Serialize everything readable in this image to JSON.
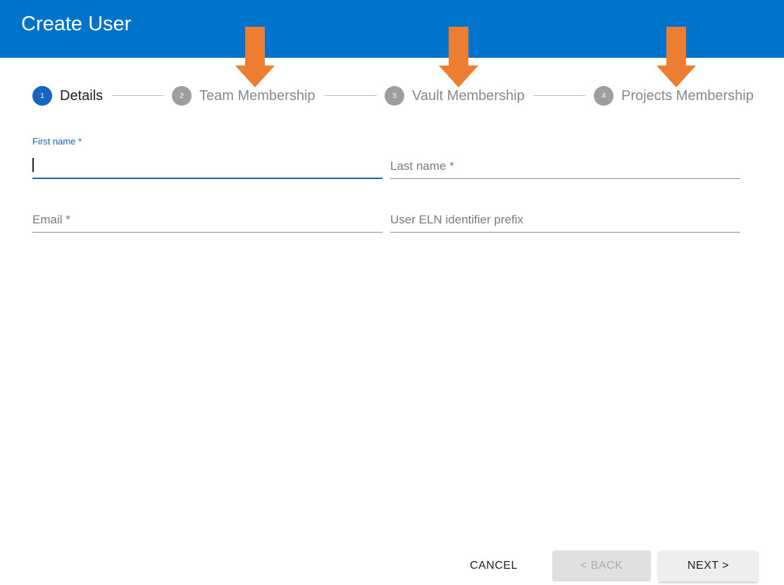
{
  "dialog": {
    "title": "Create User"
  },
  "stepper": {
    "steps": [
      {
        "number": "1",
        "label": "Details"
      },
      {
        "number": "2",
        "label": "Team Membership"
      },
      {
        "number": "3",
        "label": "Vault Membership"
      },
      {
        "number": "4",
        "label": "Projects Membership"
      }
    ],
    "active_step": 1
  },
  "form": {
    "first_name": {
      "label": "First name *",
      "value": ""
    },
    "last_name": {
      "placeholder": "Last name *",
      "value": ""
    },
    "email": {
      "placeholder": "Email *",
      "value": ""
    },
    "eln_prefix": {
      "placeholder": "User ELN identifier prefix",
      "value": ""
    }
  },
  "actions": {
    "cancel_label": "CANCEL",
    "back_label": "< BACK",
    "next_label": "NEXT >"
  },
  "annotations": {
    "arrow_color": "#ED7D31",
    "arrow_icon": "down-arrow",
    "arrow_count": 3
  },
  "colors": {
    "header_bg": "#0074CC",
    "active_step": "#1565C0",
    "inactive_step": "#9E9E9E",
    "focus": "#1E5EB8"
  }
}
